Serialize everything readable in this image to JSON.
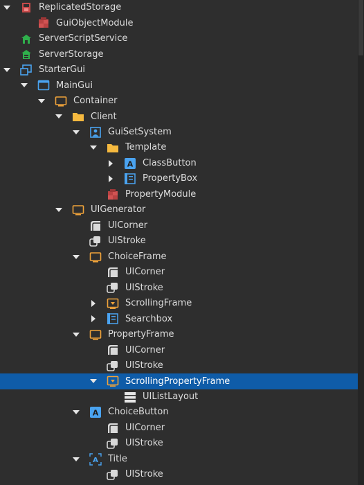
{
  "tree": [
    {
      "label": "ReplicatedStorage",
      "icon": "replicated-storage-icon",
      "arrow": "down"
    },
    {
      "label": "GuiObjectModule",
      "icon": "module-script-icon",
      "arrow": ""
    },
    {
      "label": "ServerScriptService",
      "icon": "server-script-service-icon",
      "arrow": ""
    },
    {
      "label": "ServerStorage",
      "icon": "server-storage-icon",
      "arrow": ""
    },
    {
      "label": "StarterGui",
      "icon": "starter-gui-icon",
      "arrow": "down"
    },
    {
      "label": "MainGui",
      "icon": "screen-gui-icon",
      "arrow": "down"
    },
    {
      "label": "Container",
      "icon": "frame-icon",
      "arrow": "down"
    },
    {
      "label": "Client",
      "icon": "folder-icon",
      "arrow": "down"
    },
    {
      "label": "GuiSetSystem",
      "icon": "local-script-icon",
      "arrow": "down"
    },
    {
      "label": "Template",
      "icon": "folder-icon",
      "arrow": "down"
    },
    {
      "label": "ClassButton",
      "icon": "text-button-icon",
      "arrow": "right"
    },
    {
      "label": "PropertyBox",
      "icon": "text-box-icon",
      "arrow": "right"
    },
    {
      "label": "PropertyModule",
      "icon": "module-script-icon",
      "arrow": ""
    },
    {
      "label": "UIGenerator",
      "icon": "frame-icon",
      "arrow": "down"
    },
    {
      "label": "UICorner",
      "icon": "ui-corner-icon",
      "arrow": ""
    },
    {
      "label": "UIStroke",
      "icon": "ui-stroke-icon",
      "arrow": ""
    },
    {
      "label": "ChoiceFrame",
      "icon": "frame-icon",
      "arrow": "down"
    },
    {
      "label": "UICorner",
      "icon": "ui-corner-icon",
      "arrow": ""
    },
    {
      "label": "UIStroke",
      "icon": "ui-stroke-icon",
      "arrow": ""
    },
    {
      "label": "ScrollingFrame",
      "icon": "scrolling-frame-icon",
      "arrow": "right"
    },
    {
      "label": "Searchbox",
      "icon": "text-box-icon",
      "arrow": "right"
    },
    {
      "label": "PropertyFrame",
      "icon": "frame-icon",
      "arrow": "down"
    },
    {
      "label": "UICorner",
      "icon": "ui-corner-icon",
      "arrow": ""
    },
    {
      "label": "UIStroke",
      "icon": "ui-stroke-icon",
      "arrow": ""
    },
    {
      "label": "ScrollingPropertyFrame",
      "icon": "scrolling-frame-icon",
      "arrow": "down",
      "selected": true
    },
    {
      "label": "UIListLayout",
      "icon": "ui-list-layout-icon",
      "arrow": ""
    },
    {
      "label": "ChoiceButton",
      "icon": "text-button-icon",
      "arrow": "down"
    },
    {
      "label": "UICorner",
      "icon": "ui-corner-icon",
      "arrow": ""
    },
    {
      "label": "UIStroke",
      "icon": "ui-stroke-icon",
      "arrow": ""
    },
    {
      "label": "Title",
      "icon": "text-label-icon",
      "arrow": "down"
    },
    {
      "label": "UIStroke",
      "icon": "ui-stroke-icon",
      "arrow": ""
    }
  ],
  "colors": {
    "background": "#2e2e2e",
    "selected": "#0f5ca8",
    "text": "#dcdcdc",
    "frame_icon": "#f0a33a",
    "folder_icon": "#f5b93f",
    "module_icon": "#c64a4a",
    "service_icon": "#2fb04c",
    "gui_icon": "#4aa3f0"
  }
}
